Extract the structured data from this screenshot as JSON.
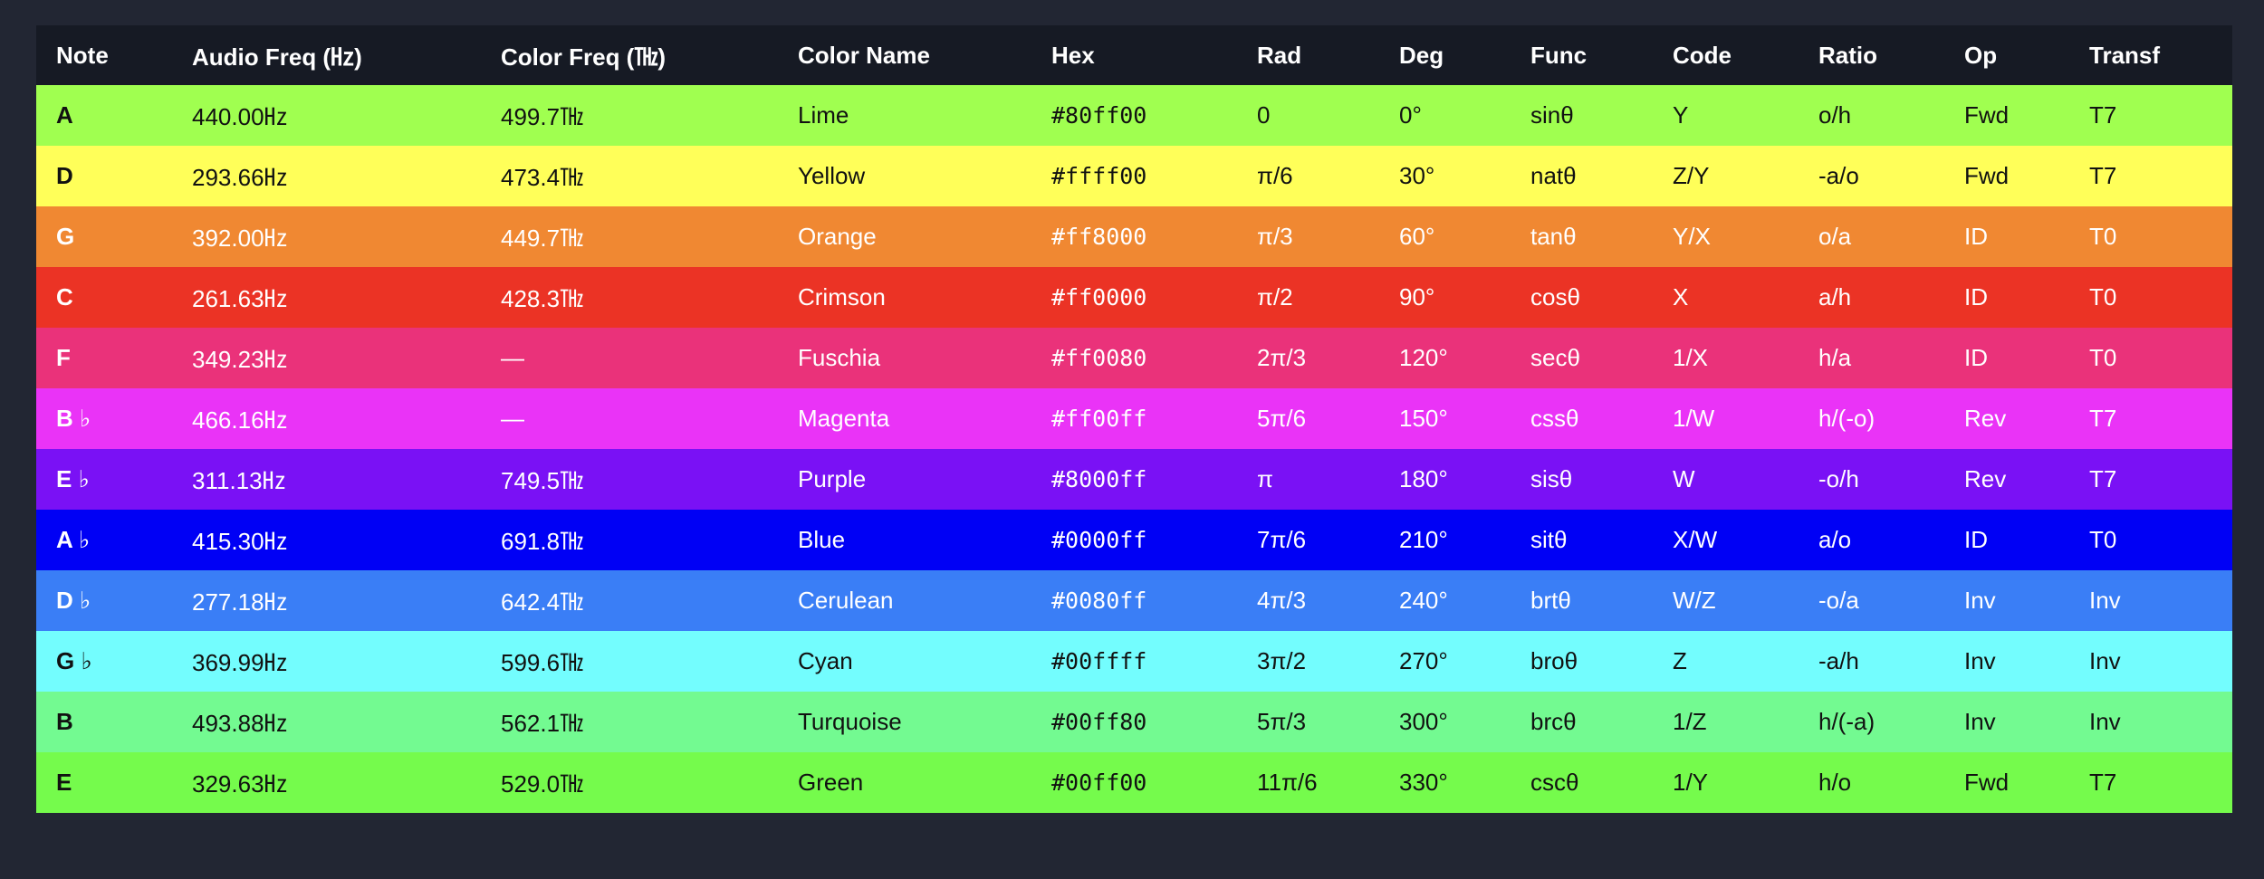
{
  "table": {
    "headers": [
      "Note",
      "Audio Freq (㎐)",
      "Color Freq (㎔)",
      "Color Name",
      "Hex",
      "Rad",
      "Deg",
      "Func",
      "Code",
      "Ratio",
      "Op",
      "Transf"
    ],
    "rows": [
      {
        "bg": "#a0ff50",
        "text": "dark",
        "cells": [
          "A",
          "440.00㎐",
          "499.7㎔",
          "Lime",
          "#80ff00",
          "0",
          "0°",
          "sinθ",
          "Y",
          "o/h",
          "Fwd",
          "T7"
        ]
      },
      {
        "bg": "#ffff59",
        "text": "dark",
        "cells": [
          "D",
          "293.66㎐",
          "473.4㎔",
          "Yellow",
          "#ffff00",
          "π/6",
          "30°",
          "natθ",
          "Z/Y",
          "-a/o",
          "Fwd",
          "T7"
        ]
      },
      {
        "bg": "#f08832",
        "text": "light",
        "cells": [
          "G",
          "392.00㎐",
          "449.7㎔",
          "Orange",
          "#ff8000",
          "π/3",
          "60°",
          "tanθ",
          "Y/X",
          "o/a",
          "ID",
          "T0"
        ]
      },
      {
        "bg": "#eb3325",
        "text": "light",
        "cells": [
          "C",
          "261.63㎐",
          "428.3㎔",
          "Crimson",
          "#ff0000",
          "π/2",
          "90°",
          "cosθ",
          "X",
          "a/h",
          "ID",
          "T0"
        ]
      },
      {
        "bg": "#ea327a",
        "text": "light",
        "cells": [
          "F",
          "349.23㎐",
          "—",
          "Fuschia",
          "#ff0080",
          "2π/3",
          "120°",
          "secθ",
          "1/X",
          "h/a",
          "ID",
          "T0"
        ]
      },
      {
        "bg": "#ea33f7",
        "text": "light",
        "cells": [
          "B ♭",
          "466.16㎐",
          "—",
          "Magenta",
          "#ff00ff",
          "5π/6",
          "150°",
          "cssθ",
          "1/W",
          "h/(-o)",
          "Rev",
          "T7"
        ]
      },
      {
        "bg": "#7a11f5",
        "text": "light",
        "cells": [
          "E ♭",
          "311.13㎐",
          "749.5㎔",
          "Purple",
          "#8000ff",
          "π",
          "180°",
          "sisθ",
          "W",
          "-o/h",
          "Rev",
          "T7"
        ]
      },
      {
        "bg": "#0000f5",
        "text": "light",
        "cells": [
          "A ♭",
          "415.30㎐",
          "691.8㎔",
          "Blue",
          "#0000ff",
          "7π/6",
          "210°",
          "sitθ",
          "X/W",
          "a/o",
          "ID",
          "T0"
        ]
      },
      {
        "bg": "#3a7ef6",
        "text": "light",
        "cells": [
          "D ♭",
          "277.18㎐",
          "642.4㎔",
          "Cerulean",
          "#0080ff",
          "4π/3",
          "240°",
          "brtθ",
          "W/Z",
          "-o/a",
          "Inv",
          "Inv"
        ]
      },
      {
        "bg": "#73fdfe",
        "text": "dark",
        "cells": [
          "G ♭",
          "369.99㎐",
          "599.6㎔",
          "Cyan",
          "#00ffff",
          "3π/2",
          "270°",
          "broθ",
          "Z",
          "-a/h",
          "Inv",
          "Inv"
        ]
      },
      {
        "bg": "#73fa91",
        "text": "dark",
        "cells": [
          "B",
          "493.88㎐",
          "562.1㎔",
          "Turquoise",
          "#00ff80",
          "5π/3",
          "300°",
          "brcθ",
          "1/Z",
          "h/(-a)",
          "Inv",
          "Inv"
        ]
      },
      {
        "bg": "#75fb4c",
        "text": "dark",
        "cells": [
          "E",
          "329.63㎐",
          "529.0㎔",
          "Green",
          "#00ff00",
          "11π/6",
          "330°",
          "cscθ",
          "1/Y",
          "h/o",
          "Fwd",
          "T7"
        ]
      }
    ]
  }
}
